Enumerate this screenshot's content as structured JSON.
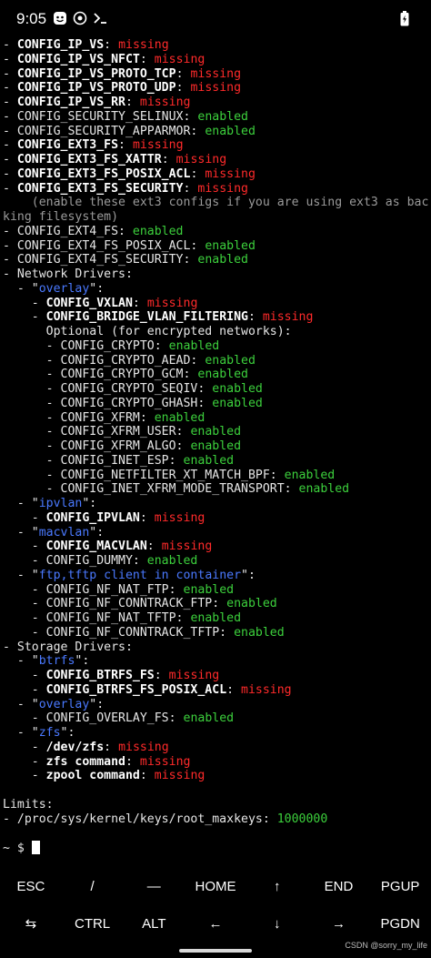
{
  "status_bar": {
    "time": "9:05",
    "icons": [
      "notification-icon",
      "media-icon",
      "terminal-prompt-icon",
      "battery-icon"
    ]
  },
  "terminal": {
    "lines": [
      [
        {
          "t": "- ",
          "c": "key-norm"
        },
        {
          "t": "CONFIG_IP_VS",
          "c": "key-bold"
        },
        {
          "t": ": ",
          "c": "key-norm"
        },
        {
          "t": "missing",
          "c": "status-missing"
        }
      ],
      [
        {
          "t": "- ",
          "c": "key-norm"
        },
        {
          "t": "CONFIG_IP_VS_NFCT",
          "c": "key-bold"
        },
        {
          "t": ": ",
          "c": "key-norm"
        },
        {
          "t": "missing",
          "c": "status-missing"
        }
      ],
      [
        {
          "t": "- ",
          "c": "key-norm"
        },
        {
          "t": "CONFIG_IP_VS_PROTO_TCP",
          "c": "key-bold"
        },
        {
          "t": ": ",
          "c": "key-norm"
        },
        {
          "t": "missing",
          "c": "status-missing"
        }
      ],
      [
        {
          "t": "- ",
          "c": "key-norm"
        },
        {
          "t": "CONFIG_IP_VS_PROTO_UDP",
          "c": "key-bold"
        },
        {
          "t": ": ",
          "c": "key-norm"
        },
        {
          "t": "missing",
          "c": "status-missing"
        }
      ],
      [
        {
          "t": "- ",
          "c": "key-norm"
        },
        {
          "t": "CONFIG_IP_VS_RR",
          "c": "key-bold"
        },
        {
          "t": ": ",
          "c": "key-norm"
        },
        {
          "t": "missing",
          "c": "status-missing"
        }
      ],
      [
        {
          "t": "- CONFIG_SECURITY_SELINUX: ",
          "c": "key-norm"
        },
        {
          "t": "enabled",
          "c": "status-enabled"
        }
      ],
      [
        {
          "t": "- CONFIG_SECURITY_APPARMOR: ",
          "c": "key-norm"
        },
        {
          "t": "enabled",
          "c": "status-enabled"
        }
      ],
      [
        {
          "t": "- ",
          "c": "key-norm"
        },
        {
          "t": "CONFIG_EXT3_FS",
          "c": "key-bold"
        },
        {
          "t": ": ",
          "c": "key-norm"
        },
        {
          "t": "missing",
          "c": "status-missing"
        }
      ],
      [
        {
          "t": "- ",
          "c": "key-norm"
        },
        {
          "t": "CONFIG_EXT3_FS_XATTR",
          "c": "key-bold"
        },
        {
          "t": ": ",
          "c": "key-norm"
        },
        {
          "t": "missing",
          "c": "status-missing"
        }
      ],
      [
        {
          "t": "- ",
          "c": "key-norm"
        },
        {
          "t": "CONFIG_EXT3_FS_POSIX_ACL",
          "c": "key-bold"
        },
        {
          "t": ": ",
          "c": "key-norm"
        },
        {
          "t": "missing",
          "c": "status-missing"
        }
      ],
      [
        {
          "t": "- ",
          "c": "key-norm"
        },
        {
          "t": "CONFIG_EXT3_FS_SECURITY",
          "c": "key-bold"
        },
        {
          "t": ": ",
          "c": "key-norm"
        },
        {
          "t": "missing",
          "c": "status-missing"
        }
      ],
      [
        {
          "t": "    (enable these ext3 configs if you are using ext3 as bac",
          "c": "dim"
        }
      ],
      [
        {
          "t": "king filesystem)",
          "c": "dim"
        }
      ],
      [
        {
          "t": "- CONFIG_EXT4_FS: ",
          "c": "key-norm"
        },
        {
          "t": "enabled",
          "c": "status-enabled"
        }
      ],
      [
        {
          "t": "- CONFIG_EXT4_FS_POSIX_ACL: ",
          "c": "key-norm"
        },
        {
          "t": "enabled",
          "c": "status-enabled"
        }
      ],
      [
        {
          "t": "- CONFIG_EXT4_FS_SECURITY: ",
          "c": "key-norm"
        },
        {
          "t": "enabled",
          "c": "status-enabled"
        }
      ],
      [
        {
          "t": "- Network Drivers:",
          "c": "key-norm"
        }
      ],
      [
        {
          "t": "  - \"",
          "c": "key-norm"
        },
        {
          "t": "overlay",
          "c": "quoted"
        },
        {
          "t": "\":",
          "c": "key-norm"
        }
      ],
      [
        {
          "t": "    - ",
          "c": "key-norm"
        },
        {
          "t": "CONFIG_VXLAN",
          "c": "key-bold"
        },
        {
          "t": ": ",
          "c": "key-norm"
        },
        {
          "t": "missing",
          "c": "status-missing"
        }
      ],
      [
        {
          "t": "    - ",
          "c": "key-norm"
        },
        {
          "t": "CONFIG_BRIDGE_VLAN_FILTERING",
          "c": "key-bold"
        },
        {
          "t": ": ",
          "c": "key-norm"
        },
        {
          "t": "missing",
          "c": "status-missing"
        }
      ],
      [
        {
          "t": "      Optional (for encrypted networks):",
          "c": "key-norm"
        }
      ],
      [
        {
          "t": "      - CONFIG_CRYPTO: ",
          "c": "key-norm"
        },
        {
          "t": "enabled",
          "c": "status-enabled"
        }
      ],
      [
        {
          "t": "      - CONFIG_CRYPTO_AEAD: ",
          "c": "key-norm"
        },
        {
          "t": "enabled",
          "c": "status-enabled"
        }
      ],
      [
        {
          "t": "      - CONFIG_CRYPTO_GCM: ",
          "c": "key-norm"
        },
        {
          "t": "enabled",
          "c": "status-enabled"
        }
      ],
      [
        {
          "t": "      - CONFIG_CRYPTO_SEQIV: ",
          "c": "key-norm"
        },
        {
          "t": "enabled",
          "c": "status-enabled"
        }
      ],
      [
        {
          "t": "      - CONFIG_CRYPTO_GHASH: ",
          "c": "key-norm"
        },
        {
          "t": "enabled",
          "c": "status-enabled"
        }
      ],
      [
        {
          "t": "      - CONFIG_XFRM: ",
          "c": "key-norm"
        },
        {
          "t": "enabled",
          "c": "status-enabled"
        }
      ],
      [
        {
          "t": "      - CONFIG_XFRM_USER: ",
          "c": "key-norm"
        },
        {
          "t": "enabled",
          "c": "status-enabled"
        }
      ],
      [
        {
          "t": "      - CONFIG_XFRM_ALGO: ",
          "c": "key-norm"
        },
        {
          "t": "enabled",
          "c": "status-enabled"
        }
      ],
      [
        {
          "t": "      - CONFIG_INET_ESP: ",
          "c": "key-norm"
        },
        {
          "t": "enabled",
          "c": "status-enabled"
        }
      ],
      [
        {
          "t": "      - CONFIG_NETFILTER_XT_MATCH_BPF: ",
          "c": "key-norm"
        },
        {
          "t": "enabled",
          "c": "status-enabled"
        }
      ],
      [
        {
          "t": "      - CONFIG_INET_XFRM_MODE_TRANSPORT: ",
          "c": "key-norm"
        },
        {
          "t": "enabled",
          "c": "status-enabled"
        }
      ],
      [
        {
          "t": "  - \"",
          "c": "key-norm"
        },
        {
          "t": "ipvlan",
          "c": "quoted"
        },
        {
          "t": "\":",
          "c": "key-norm"
        }
      ],
      [
        {
          "t": "    - ",
          "c": "key-norm"
        },
        {
          "t": "CONFIG_IPVLAN",
          "c": "key-bold"
        },
        {
          "t": ": ",
          "c": "key-norm"
        },
        {
          "t": "missing",
          "c": "status-missing"
        }
      ],
      [
        {
          "t": "  - \"",
          "c": "key-norm"
        },
        {
          "t": "macvlan",
          "c": "quoted"
        },
        {
          "t": "\":",
          "c": "key-norm"
        }
      ],
      [
        {
          "t": "    - ",
          "c": "key-norm"
        },
        {
          "t": "CONFIG_MACVLAN",
          "c": "key-bold"
        },
        {
          "t": ": ",
          "c": "key-norm"
        },
        {
          "t": "missing",
          "c": "status-missing"
        }
      ],
      [
        {
          "t": "    - CONFIG_DUMMY: ",
          "c": "key-norm"
        },
        {
          "t": "enabled",
          "c": "status-enabled"
        }
      ],
      [
        {
          "t": "  - \"",
          "c": "key-norm"
        },
        {
          "t": "ftp,tftp client in container",
          "c": "quoted"
        },
        {
          "t": "\":",
          "c": "key-norm"
        }
      ],
      [
        {
          "t": "    - CONFIG_NF_NAT_FTP: ",
          "c": "key-norm"
        },
        {
          "t": "enabled",
          "c": "status-enabled"
        }
      ],
      [
        {
          "t": "    - CONFIG_NF_CONNTRACK_FTP: ",
          "c": "key-norm"
        },
        {
          "t": "enabled",
          "c": "status-enabled"
        }
      ],
      [
        {
          "t": "    - CONFIG_NF_NAT_TFTP: ",
          "c": "key-norm"
        },
        {
          "t": "enabled",
          "c": "status-enabled"
        }
      ],
      [
        {
          "t": "    - CONFIG_NF_CONNTRACK_TFTP: ",
          "c": "key-norm"
        },
        {
          "t": "enabled",
          "c": "status-enabled"
        }
      ],
      [
        {
          "t": "- Storage Drivers:",
          "c": "key-norm"
        }
      ],
      [
        {
          "t": "  - \"",
          "c": "key-norm"
        },
        {
          "t": "btrfs",
          "c": "quoted"
        },
        {
          "t": "\":",
          "c": "key-norm"
        }
      ],
      [
        {
          "t": "    - ",
          "c": "key-norm"
        },
        {
          "t": "CONFIG_BTRFS_FS",
          "c": "key-bold"
        },
        {
          "t": ": ",
          "c": "key-norm"
        },
        {
          "t": "missing",
          "c": "status-missing"
        }
      ],
      [
        {
          "t": "    - ",
          "c": "key-norm"
        },
        {
          "t": "CONFIG_BTRFS_FS_POSIX_ACL",
          "c": "key-bold"
        },
        {
          "t": ": ",
          "c": "key-norm"
        },
        {
          "t": "missing",
          "c": "status-missing"
        }
      ],
      [
        {
          "t": "  - \"",
          "c": "key-norm"
        },
        {
          "t": "overlay",
          "c": "quoted"
        },
        {
          "t": "\":",
          "c": "key-norm"
        }
      ],
      [
        {
          "t": "    - CONFIG_OVERLAY_FS: ",
          "c": "key-norm"
        },
        {
          "t": "enabled",
          "c": "status-enabled"
        }
      ],
      [
        {
          "t": "  - \"",
          "c": "key-norm"
        },
        {
          "t": "zfs",
          "c": "quoted"
        },
        {
          "t": "\":",
          "c": "key-norm"
        }
      ],
      [
        {
          "t": "    - ",
          "c": "key-norm"
        },
        {
          "t": "/dev/zfs",
          "c": "key-bold"
        },
        {
          "t": ": ",
          "c": "key-norm"
        },
        {
          "t": "missing",
          "c": "status-missing"
        }
      ],
      [
        {
          "t": "    - ",
          "c": "key-norm"
        },
        {
          "t": "zfs command",
          "c": "key-bold"
        },
        {
          "t": ": ",
          "c": "key-norm"
        },
        {
          "t": "missing",
          "c": "status-missing"
        }
      ],
      [
        {
          "t": "    - ",
          "c": "key-norm"
        },
        {
          "t": "zpool command",
          "c": "key-bold"
        },
        {
          "t": ": ",
          "c": "key-norm"
        },
        {
          "t": "missing",
          "c": "status-missing"
        }
      ],
      [
        {
          "t": "",
          "c": "key-norm"
        }
      ],
      [
        {
          "t": "Limits:",
          "c": "key-norm"
        }
      ],
      [
        {
          "t": "- /proc/sys/kernel/keys/root_maxkeys: ",
          "c": "key-norm"
        },
        {
          "t": "1000000",
          "c": "value-green"
        }
      ],
      [
        {
          "t": "",
          "c": "key-norm"
        }
      ]
    ],
    "prompt": {
      "symbol": "~ $ "
    }
  },
  "extra_keys": {
    "row1": [
      "ESC",
      "/",
      "—",
      "HOME",
      "↑",
      "END",
      "PGUP"
    ],
    "row2": [
      "⇆",
      "CTRL",
      "ALT",
      "←",
      "↓",
      "→",
      "PGDN"
    ]
  },
  "watermark": "CSDN @sorry_my_life",
  "colors": {
    "missing": "#ff2a2a",
    "enabled": "#3cd03c",
    "quoted": "#4a79ff",
    "background": "#000000"
  }
}
